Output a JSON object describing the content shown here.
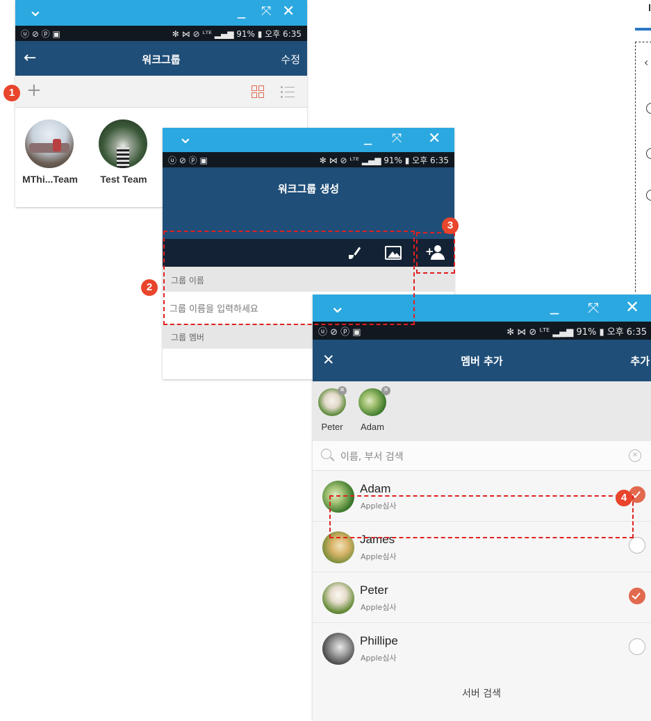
{
  "status": {
    "icons": "ⓤ ⊘ ⓟ ▣",
    "right": "✻ ⋈ ⊘ ᴸᵀᴱ ▂▄▆ 91% ▮ 오후 6:35"
  },
  "window_controls": {
    "chevron": "⌄",
    "minimize": "_",
    "restore": "⤧",
    "close": "✕"
  },
  "screen1": {
    "back": "←",
    "title": "워크그룹",
    "edit": "수정",
    "add": "+",
    "teams": [
      {
        "name": "MThi...Team"
      },
      {
        "name": "Test Team"
      }
    ]
  },
  "screen2": {
    "title": "워크그룹 생성",
    "group_name_label": "그룹 이름",
    "group_name_placeholder": "그룹 이름을 입력하세요",
    "group_member_label": "그룹 멤버"
  },
  "screen3": {
    "close": "✕",
    "title": "멤버 추가",
    "add": "추가",
    "selected": [
      {
        "name": "Peter"
      },
      {
        "name": "Adam"
      }
    ],
    "search_placeholder": "이름, 부서 검색",
    "members": [
      {
        "name": "Adam",
        "dept": "Apple심사",
        "checked": true
      },
      {
        "name": "James",
        "dept": "Apple심사",
        "checked": false
      },
      {
        "name": "Peter",
        "dept": "Apple심사",
        "checked": true
      },
      {
        "name": "Phillipe",
        "dept": "Apple심사",
        "checked": false
      }
    ],
    "server_search": "서버 검색"
  },
  "badges": [
    "1",
    "2",
    "3",
    "4"
  ],
  "colors": {
    "titlebar": "#2ba8e0",
    "statusbar": "#111820",
    "appbar": "#1f4e78",
    "accent": "#e0694e",
    "highlight": "#e02020"
  }
}
